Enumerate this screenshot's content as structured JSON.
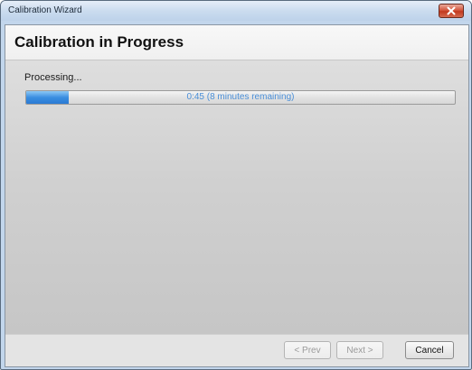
{
  "window": {
    "title": "Calibration Wizard"
  },
  "header": {
    "title": "Calibration in Progress"
  },
  "content": {
    "status_label": "Processing...",
    "progress": {
      "fraction": 0.1,
      "text": "0:45 (8 minutes remaining)"
    }
  },
  "footer": {
    "prev_label": "< Prev",
    "next_label": "Next >",
    "cancel_label": "Cancel"
  },
  "icons": {
    "close": "close-icon"
  },
  "colors": {
    "progress_fill": "#3a8ee0",
    "progress_text": "#4a8fd8",
    "close_button": "#c2391f"
  }
}
